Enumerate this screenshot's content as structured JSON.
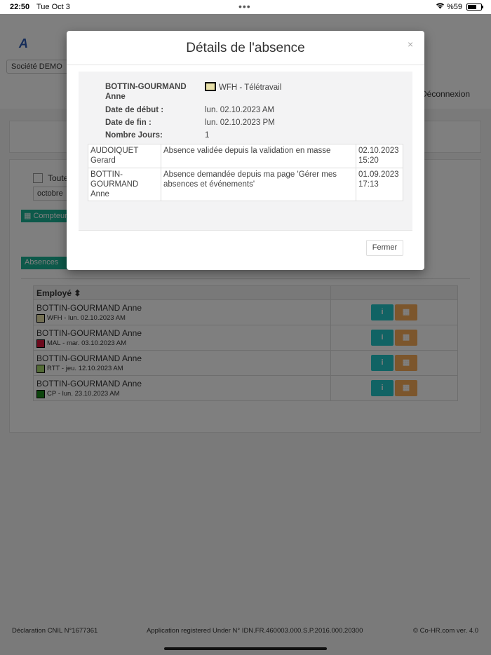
{
  "status_bar": {
    "time": "22:50",
    "date": "Tue Oct 3",
    "battery": "%59"
  },
  "header": {
    "company": "Société DEMO",
    "logout": "Déconnexion"
  },
  "filters": {
    "select_all_label": "Toute",
    "month": "octobre",
    "counters_button": "Compteurs"
  },
  "tabs": {
    "absences": "Absences"
  },
  "table": {
    "column_employee": "Employé",
    "rows": [
      {
        "name": "BOTTIN-GOURMAND Anne",
        "code": "WFH",
        "date": " - lun. 02.10.2023 AM",
        "color": "#e8e0a8"
      },
      {
        "name": "BOTTIN-GOURMAND Anne",
        "code": "MAL",
        "date": " - mar. 03.10.2023 AM",
        "color": "#d9143a"
      },
      {
        "name": "BOTTIN-GOURMAND Anne",
        "code": "RTT",
        "date": " - jeu. 12.10.2023 AM",
        "color": "#a9d86e"
      },
      {
        "name": "BOTTIN-GOURMAND Anne",
        "code": "CP",
        "date": " - lun. 23.10.2023 AM",
        "color": "#1c8a1c"
      }
    ],
    "info_label": "i",
    "calc_label": "▦"
  },
  "modal": {
    "title": "Détails de l'absence",
    "close_icon": "×",
    "employee_line1": "BOTTIN-GOURMAND",
    "employee_line2": "Anne",
    "type": "WFH - Télétravail",
    "type_color": "#e8e0a8",
    "start_label": "Date de début :",
    "start_value": "lun. 02.10.2023 AM",
    "end_label": "Date de fin :",
    "end_value": "lun. 02.10.2023 PM",
    "days_label": "Nombre Jours:",
    "days_value": "1",
    "history": [
      {
        "who1": "AUDOIQUET",
        "who2": "Gerard",
        "action": "Absence validée depuis la validation en masse",
        "action2": "",
        "date1": "02.10.2023",
        "date2": "15:20"
      },
      {
        "who1": "BOTTIN-",
        "who2": "GOURMAND Anne",
        "action": "Absence demandée depuis ma page 'Gérer mes",
        "action2": "absences et événements'",
        "date1": "01.09.2023",
        "date2": "17:13"
      }
    ],
    "close_button": "Fermer"
  },
  "footer": {
    "cnil": "Déclaration CNIL N°1677361",
    "app_registered": "Application registered Under N° IDN.FR.460003.000.S.P.2016.000.20300",
    "copyright": "© Co-HR.com ver. 4.0"
  }
}
